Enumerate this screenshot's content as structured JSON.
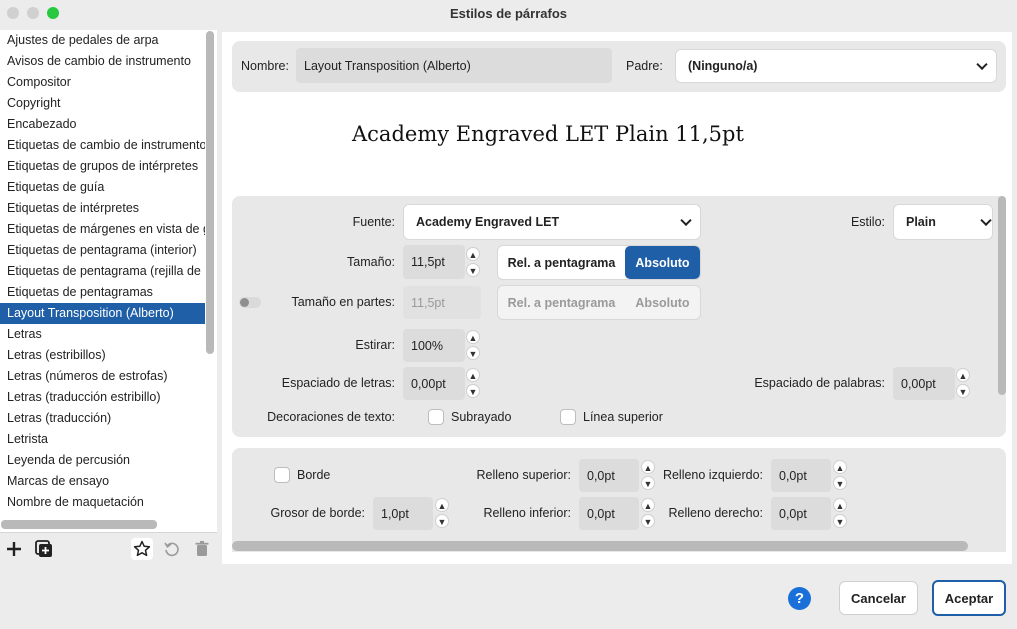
{
  "window": {
    "title": "Estilos de párrafos"
  },
  "sidebar": {
    "items": [
      "Ajustes de pedales de arpa",
      "Avisos de cambio de instrumento",
      "Compositor",
      "Copyright",
      "Encabezado",
      "Etiquetas de cambio de instrumento",
      "Etiquetas de grupos de intérpretes",
      "Etiquetas de guía",
      "Etiquetas de intérpretes",
      "Etiquetas de márgenes en vista de ga",
      "Etiquetas de pentagrama (interior)",
      "Etiquetas de pentagrama (rejilla de p",
      "Etiquetas de pentagramas",
      "Layout Transposition (Alberto)",
      "Letras",
      "Letras (estribillos)",
      "Letras (números de estrofas)",
      "Letras (traducción estribillo)",
      "Letras (traducción)",
      "Letrista",
      "Leyenda de percusión",
      "Marcas de ensayo",
      "Nombre de maquetación"
    ],
    "selected_index": 13,
    "tools": [
      "plus-icon",
      "duplicate-icon",
      "star-icon",
      "revert-icon",
      "trash-icon"
    ]
  },
  "header": {
    "name_label": "Nombre:",
    "name_value": "Layout Transposition (Alberto)",
    "parent_label": "Padre:",
    "parent_value": "(Ninguno/a)"
  },
  "preview": {
    "text": "Academy Engraved LET Plain 11,5pt"
  },
  "font": {
    "font_label": "Fuente:",
    "font_value": "Academy Engraved LET",
    "style_label": "Estilo:",
    "style_value": "Plain",
    "size_label": "Tamaño:",
    "size_value": "11,5pt",
    "rel_label": "Rel. a pentagrama",
    "abs_label": "Absoluto",
    "parts_label": "Tamaño en partes:",
    "parts_value": "11,5pt",
    "stretch_label": "Estirar:",
    "stretch_value": "100%",
    "letter_label": "Espaciado de letras:",
    "letter_value": "0,00pt",
    "word_label": "Espaciado de palabras:",
    "word_value": "0,00pt",
    "deco_label": "Decoraciones de texto:",
    "underline_label": "Subrayado",
    "overline_label": "Línea superior"
  },
  "border": {
    "border_label": "Borde",
    "width_label": "Grosor de borde:",
    "width_value": "1,0pt",
    "pad_top_label": "Relleno superior:",
    "pad_top_value": "0,0pt",
    "pad_bottom_label": "Relleno inferior:",
    "pad_bottom_value": "0,0pt",
    "pad_left_label": "Relleno izquierdo:",
    "pad_left_value": "0,0pt",
    "pad_right_label": "Relleno derecho:",
    "pad_right_value": "0,0pt"
  },
  "footer": {
    "help": "?",
    "cancel": "Cancelar",
    "ok": "Aceptar"
  },
  "colors": {
    "accent": "#1f5fa7",
    "help": "#1a6fd8",
    "close": "#ff5f57",
    "min": "#febc2e",
    "max": "#28c840"
  }
}
